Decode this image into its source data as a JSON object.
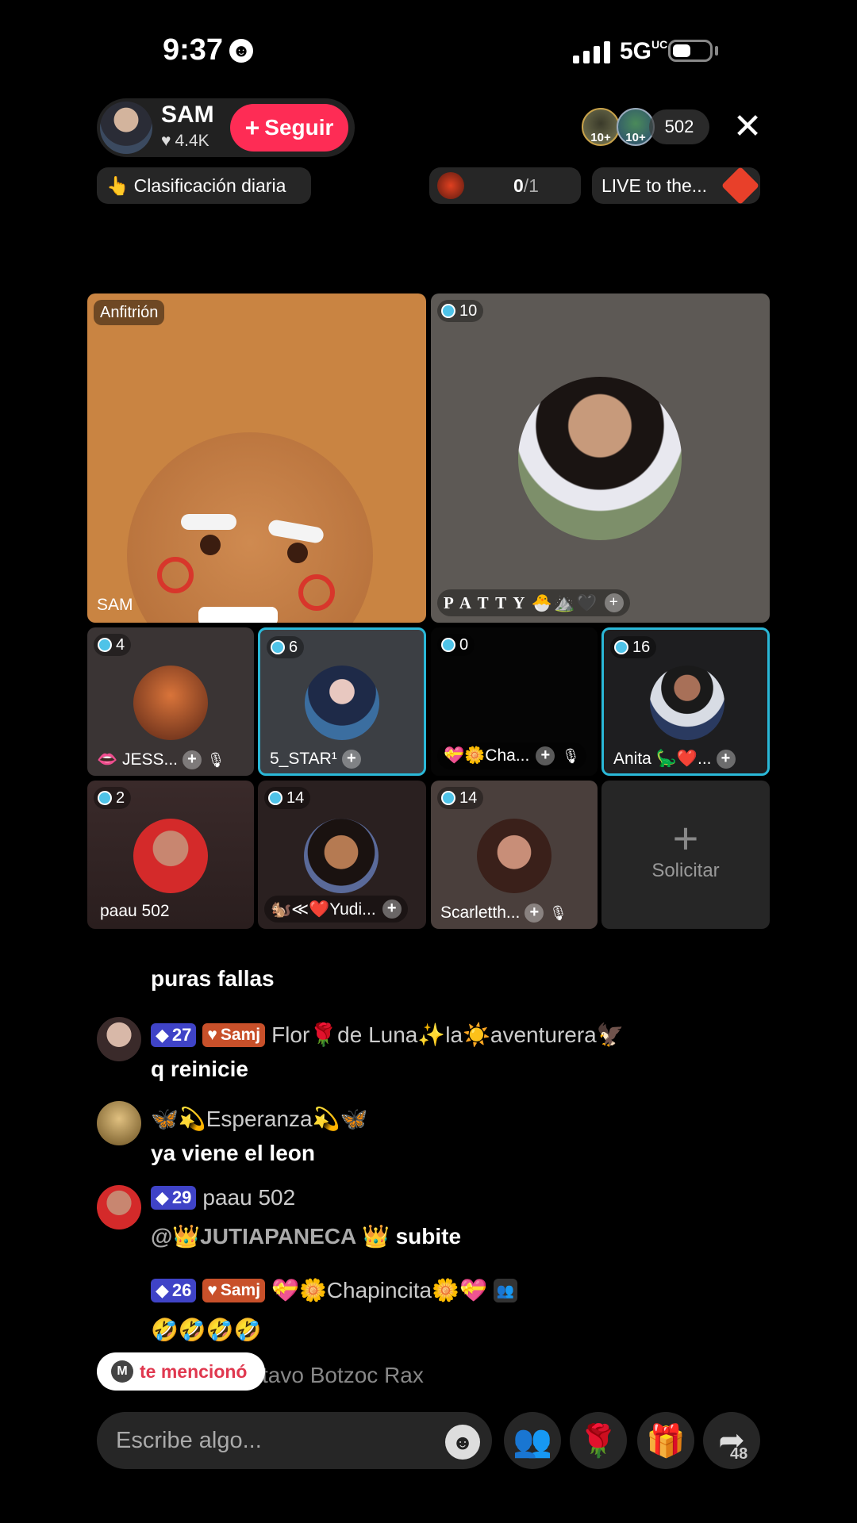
{
  "status": {
    "time": "9:37",
    "network": "5G",
    "network_sup": "UC"
  },
  "host": {
    "name": "SAM",
    "likes": "4.4K",
    "follow_label": "Seguir"
  },
  "viewers": {
    "badge1": "10+",
    "badge2": "10+",
    "count": "502"
  },
  "ranking": {
    "label": "Clasificación diaria"
  },
  "score": {
    "value": "0",
    "total": "/1"
  },
  "live_promo": {
    "label": "LIVE to the..."
  },
  "grid": {
    "host_tag": "Anfitrión",
    "host_name": "SAM",
    "tiles": [
      {
        "score": "10",
        "name": "P A T T Y 🐣⛰️🖤"
      },
      {
        "score": "4",
        "name": "👄 JESS..."
      },
      {
        "score": "6",
        "name": "5_STAR¹"
      },
      {
        "score": "0",
        "name": "💝🌼Cha..."
      },
      {
        "score": "16",
        "name": "Anita 🦕❤️..."
      },
      {
        "score": "2",
        "name": "paau 502"
      },
      {
        "score": "14",
        "name": "🐿️≪❤️Yudi..."
      },
      {
        "score": "14",
        "name": "Scarletth..."
      }
    ],
    "request_label": "Solicitar"
  },
  "chat": {
    "partial_top": "puras fallas",
    "messages": [
      {
        "level": "27",
        "fan": "Samj",
        "user": "Flor🌹de Luna✨la☀️aventurera🦅",
        "text": "q reinicie"
      },
      {
        "user": "🦋💫Esperanza💫🦋",
        "text": "ya viene el leon"
      },
      {
        "level": "29",
        "user": "paau 502",
        "mention": "@👑JUTIAPANECA 👑",
        "text": "subite"
      },
      {
        "level": "26",
        "fan": "Samj",
        "user": "💝🌼Chapincita🌼💝",
        "text": "🤣🤣🤣🤣"
      }
    ],
    "partial_bottom": "tavo Botzoc Rax"
  },
  "mention_chip": {
    "initial": "M",
    "label": "te mencionó"
  },
  "composer": {
    "placeholder": "Escribe algo...",
    "share_count": "48"
  },
  "colors": {
    "follow": "#fe2c55",
    "active_border": "#2ab8d8",
    "level_badge": "#3f43c7",
    "fan_badge": "#c8502a"
  }
}
